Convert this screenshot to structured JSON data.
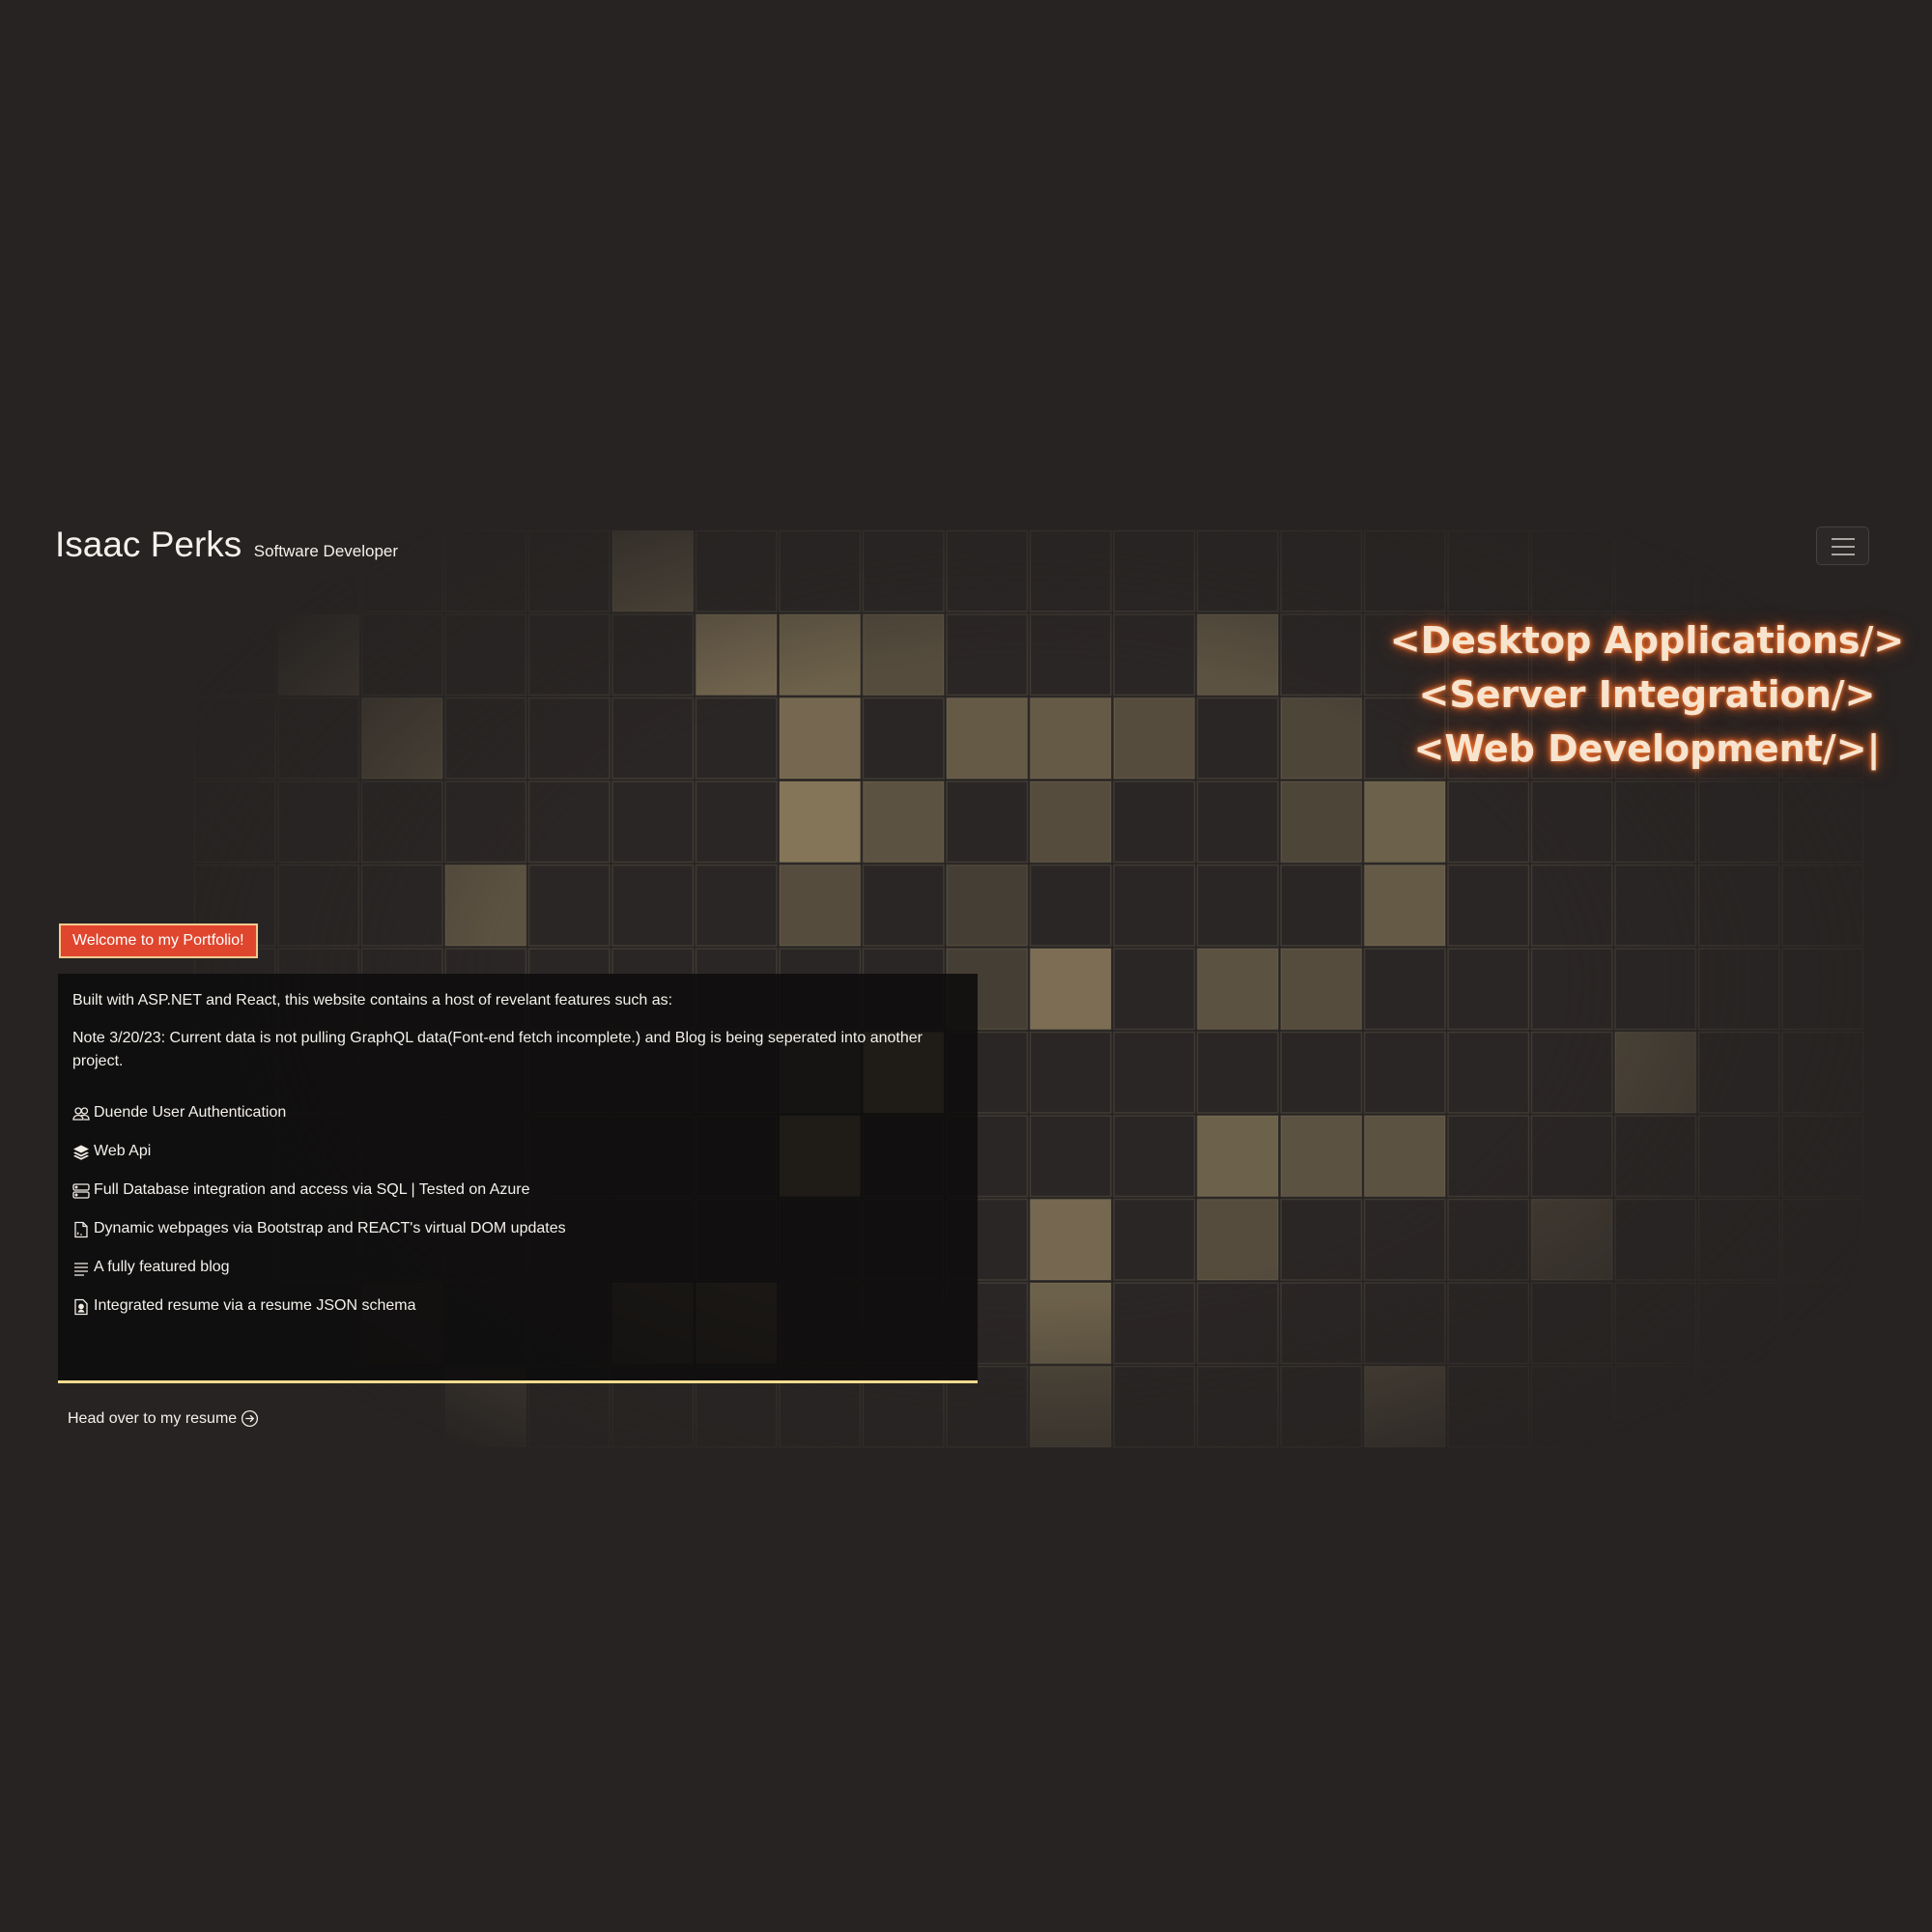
{
  "header": {
    "name": "Isaac Perks",
    "subtitle": "Software Developer"
  },
  "nav": {
    "toggle_icon": "hamburger-menu-icon"
  },
  "tagline": [
    "<Desktop Applications/>",
    "<Server Integration/>",
    "<Web Development/>|"
  ],
  "badge": "Welcome to my Portfolio!",
  "intro": {
    "description": "Built with ASP.NET and React, this website contains a host of revelant features such as:",
    "note": "Note 3/20/23: Current data is not pulling GraphQL data(Font-end fetch incomplete.) and Blog is being seperated into another project."
  },
  "features": [
    {
      "icon": "users-icon",
      "label": "Duende User Authentication"
    },
    {
      "icon": "layers-icon",
      "label": "Web Api"
    },
    {
      "icon": "database-icon",
      "label": "Full Database integration and access via SQL | Tested on Azure"
    },
    {
      "icon": "file-code-icon",
      "label": "Dynamic webpages via Bootstrap and REACT's virtual DOM updates"
    },
    {
      "icon": "list-icon",
      "label": "A fully featured blog"
    },
    {
      "icon": "resume-file-icon",
      "label": "Integrated resume via a resume JSON schema"
    }
  ],
  "resume_link": {
    "label": "Head over to my resume",
    "icon": "arrow-right-circle-icon"
  },
  "colors": {
    "background": "#262322",
    "badge": "#e0462e",
    "panel_border": "#f2dc8d",
    "tile_highlight": "#8a7858",
    "glow": "#ff7a2e"
  }
}
